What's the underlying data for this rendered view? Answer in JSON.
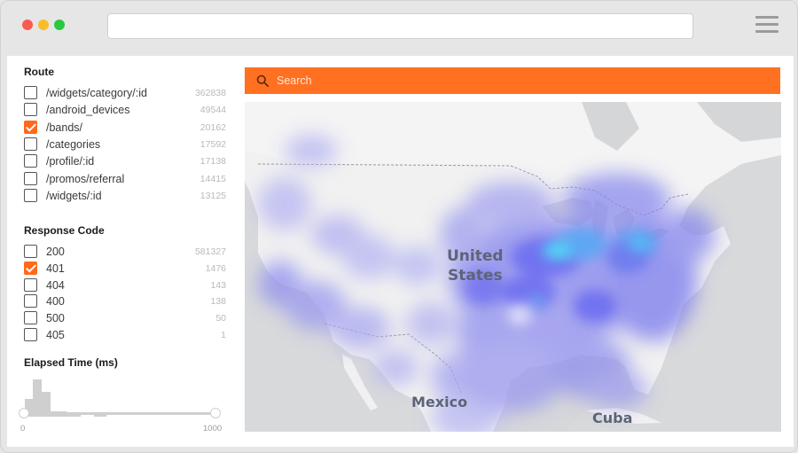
{
  "search": {
    "placeholder": "Search"
  },
  "route": {
    "title": "Route",
    "items": [
      {
        "label": "/widgets/category/:id",
        "count": "362838",
        "checked": false
      },
      {
        "label": "/android_devices",
        "count": "49544",
        "checked": false
      },
      {
        "label": "/bands/",
        "count": "20162",
        "checked": true
      },
      {
        "label": "/categories",
        "count": "17592",
        "checked": false
      },
      {
        "label": "/profile/:id",
        "count": "17138",
        "checked": false
      },
      {
        "label": "/promos/referral",
        "count": "14415",
        "checked": false
      },
      {
        "label": "/widgets/:id",
        "count": "13125",
        "checked": false
      }
    ]
  },
  "response_code": {
    "title": "Response Code",
    "items": [
      {
        "label": "200",
        "count": "581327",
        "checked": false
      },
      {
        "label": "401",
        "count": "1476",
        "checked": true
      },
      {
        "label": "404",
        "count": "143",
        "checked": false
      },
      {
        "label": "400",
        "count": "138",
        "checked": false
      },
      {
        "label": "500",
        "count": "50",
        "checked": false
      },
      {
        "label": "405",
        "count": "1",
        "checked": false
      }
    ]
  },
  "elapsed_time": {
    "title": "Elapsed Time (ms)",
    "min": "0",
    "max": "1000",
    "range_start": 0,
    "range_end": 1000
  },
  "map": {
    "labels": {
      "us_line1": "United",
      "us_line2": "States",
      "mexico": "Mexico",
      "cuba": "Cuba"
    }
  },
  "colors": {
    "accent": "#ff6a1a",
    "heat_low": "#a9a8f0",
    "heat_mid": "#6a6af0",
    "heat_high": "#4ce0f5"
  },
  "icons": {
    "search": "search-icon",
    "menu": "hamburger-menu-icon"
  }
}
